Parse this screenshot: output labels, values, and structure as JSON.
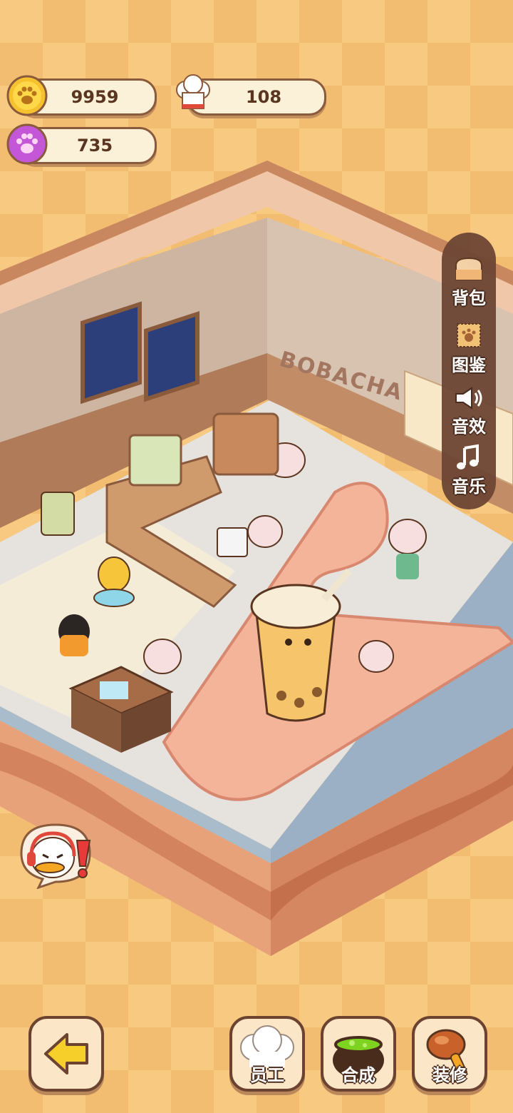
{
  "resources": {
    "coins": "9959",
    "chef_hats": "108",
    "paws": "735"
  },
  "shop": {
    "sign": "BOBACHA"
  },
  "side_menu": {
    "items": [
      {
        "label": "背包",
        "icon": "backpack-icon"
      },
      {
        "label": "图鉴",
        "icon": "collection-stamp-icon"
      },
      {
        "label": "音效",
        "icon": "speaker-icon"
      },
      {
        "label": "音乐",
        "icon": "music-note-icon"
      }
    ]
  },
  "bottom_bar": {
    "back_icon": "arrow-left-icon",
    "staff_label": "员工",
    "synthesize_label": "合成",
    "decorate_label": "装修"
  },
  "colors": {
    "background": "#f7c981",
    "panel": "#6d4634",
    "pill": "#fbf1d9",
    "gold": "#f5c12e",
    "purple": "#c357d8"
  }
}
